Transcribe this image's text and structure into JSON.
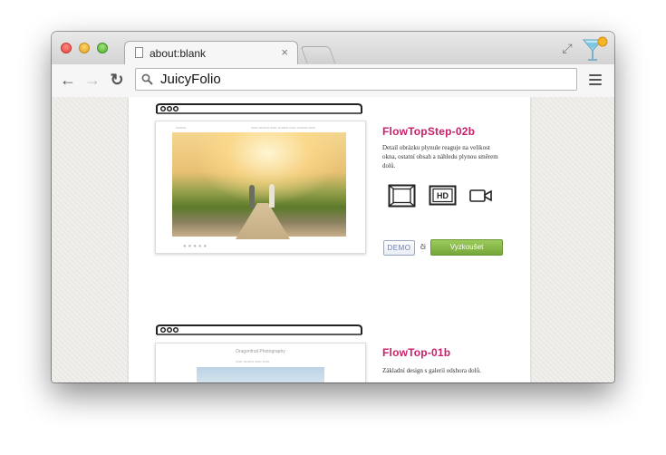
{
  "browser": {
    "tab_title": "about:blank",
    "tab_close": "×",
    "address": "JuicyFolio",
    "icons": [
      "document-icon",
      "close-icon",
      "new-tab-button",
      "fullscreen-icon",
      "cocktail-icon",
      "back-icon",
      "forward-icon",
      "reload-icon",
      "search-icon",
      "menu-icon"
    ]
  },
  "themes": [
    {
      "name": "FlowTopStep-02b",
      "description": "Detail obrázku plynule reaguje na velikost okna, ostatní obsah a náhledu plynou směrem dolů.",
      "features": [
        "fullscreen-feature-icon",
        "hd-feature-icon",
        "video-feature-icon"
      ],
      "demo_label": "DEMO",
      "or_label": "či",
      "try_label": "Vyzkoušet"
    },
    {
      "name": "FlowTop-01b",
      "description": "Základní design s galerií odshora dolů.",
      "preview_site_title": "Dragonfruit Photography",
      "features": [
        "fullscreen-feature-icon",
        "hd-feature-icon",
        "video-feature-icon"
      ]
    }
  ],
  "colors": {
    "accent": "#c8206a",
    "try_button": "#8bbb4b",
    "demo_border": "#9aa6c8"
  }
}
